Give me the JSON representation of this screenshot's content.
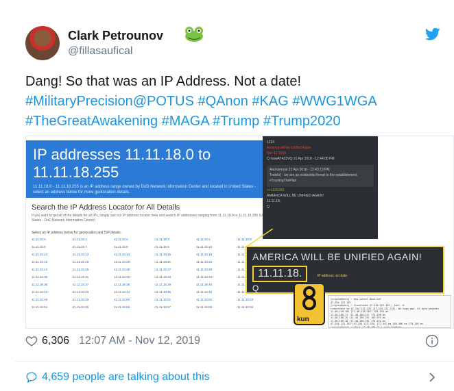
{
  "author": {
    "name": "Clark Petrounov",
    "handle": "@fillasaufical"
  },
  "tweet": {
    "line1": "Dang! So that was an IP Address. Not a date!",
    "hashtags_line2": "#MilitaryPrecision@POTUS #QAnon #KAG #WWG1WGA",
    "hashtags_line3": "#TheGreatAwakening #MAGA #Trump #Trump2020"
  },
  "media": {
    "ip_title": "IP addresses 11.11.18.0 to 11.11.18.255",
    "ip_subtitle": "11.11.18.0 - 11.11.18.255 is an IP address range owned by DoD Network Information Center and located in United States - select an address below for more geolocation details.",
    "locator_title": "Search the IP Address Locator for All Details",
    "locator_sub": "If you want to get all of the details for all IPs, simply use our IP address locator here and search IP addresses ranging from 11.11.18.0 to 11.11.18.255 (United States - DoD Network Information Center)",
    "select_label": "Select an IP address below for geolocation and ISP details :",
    "ip_cells": [
      "11.11.18.0",
      "11.11.18.1",
      "11.11.18.2",
      "11.11.18.3",
      "11.11.18.4",
      "11.11.18.5",
      "11.11.18.6",
      "11.11.18.7",
      "11.11.18.8",
      "11.11.18.9",
      "11.11.18.10",
      "11.11.18.11",
      "11.11.18.12",
      "11.11.18.13",
      "11.11.18.14",
      "11.11.18.15",
      "11.11.18.16",
      "11.11.18.17",
      "11.11.18.18",
      "11.11.18.19",
      "11.11.18.20",
      "11.11.18.21",
      "11.11.18.22",
      "11.11.18.23",
      "11.11.18.24",
      "11.11.18.25",
      "11.11.18.26",
      "11.11.18.27",
      "11.11.18.28",
      "11.11.18.29",
      "11.11.18.30",
      "11.11.18.31",
      "11.11.18.32",
      "11.11.18.33",
      "11.11.18.34",
      "11.11.18.35",
      "11.11.18.36",
      "11.11.18.37",
      "11.11.18.38",
      "11.11.18.39",
      "11.11.18.40",
      "11.11.18.41",
      "11.11.18.42",
      "11.11.18.43",
      "11.11.18.44",
      "11.11.18.45",
      "11.11.18.46",
      "11.11.18.47",
      "11.11.18.48",
      "11.11.18.49",
      "11.11.18.50",
      "11.11.18.51",
      "11.11.18.52",
      "11.11.18.53",
      "11.11.18.54",
      "11.11.18.55",
      "11.11.18.56",
      "11.11.18.57",
      "11.11.18.58",
      "11.11.18.59"
    ],
    "q_number": "1234",
    "q_title": "America will be Unified Again",
    "q_date": "Nov 11 2018",
    "q_author": "Q !xowAT4Z3VQ",
    "q_timestamp": "21 Apr 2018 - 12:44:08 PM",
    "q_anon": "Anonymous",
    "q_anon_time": "21 Apr 2018 - 12:43:13 PM",
    "q_anon_text": "Trololo} - we are an existential threat to the establishment.",
    "q_anon_tag": "#TrustingThePlan",
    "q_reply_ref": ">>1226283",
    "q_reply_text": "AMERICA WILL BE UNIFIED AGAIN!",
    "q_reply_ip": "11.11.18.",
    "q_letter": "Q",
    "america_title": "AMERICA WILL BE UNIFIED AGAIN!",
    "america_ip": "11.11.18.",
    "america_note": "IP address not date.",
    "america_q": "Q",
    "kun_label": "kun",
    "terminal_lines": [
      "[crypto@host] ~ dig +short 8kun.net",
      "47.254.122.135",
      "[crypto@host] ~ traceroute 47.254.122.135 | tail -6",
      "traceroute to 47.254.122.135 (47.254.122.135), 64 hops max, 52 byte packets",
      "  11.40.218.181 (11.40.218.181)  161.924 ms",
      "  11.40.100.11 (11.40.100.11)  172.436 ms",
      "  11.40.180.25 (11.40.180.25)  183.975 ms",
      "  11.40.100.18 (11.40.100.18)  176.410 ms",
      "  47.254.122.135 (47.254.122.135)  177.447 ms  184.406 ms  175.116 ms",
      "[crypto@host] ~ whois 11.40.100.25 | grep OrgName",
      "OrgName:        DoD Network Information Center",
      "[crypto@host] ~ |"
    ]
  },
  "meta": {
    "likes": "6,306",
    "timestamp": "12:07 AM - Nov 12, 2019"
  },
  "footer": {
    "talking": "4,659 people are talking about this"
  },
  "colors": {
    "link": "#1b95e0",
    "secondary": "#657786",
    "ip_header": "#2b7bd6",
    "highlight": "#f4d53a"
  }
}
